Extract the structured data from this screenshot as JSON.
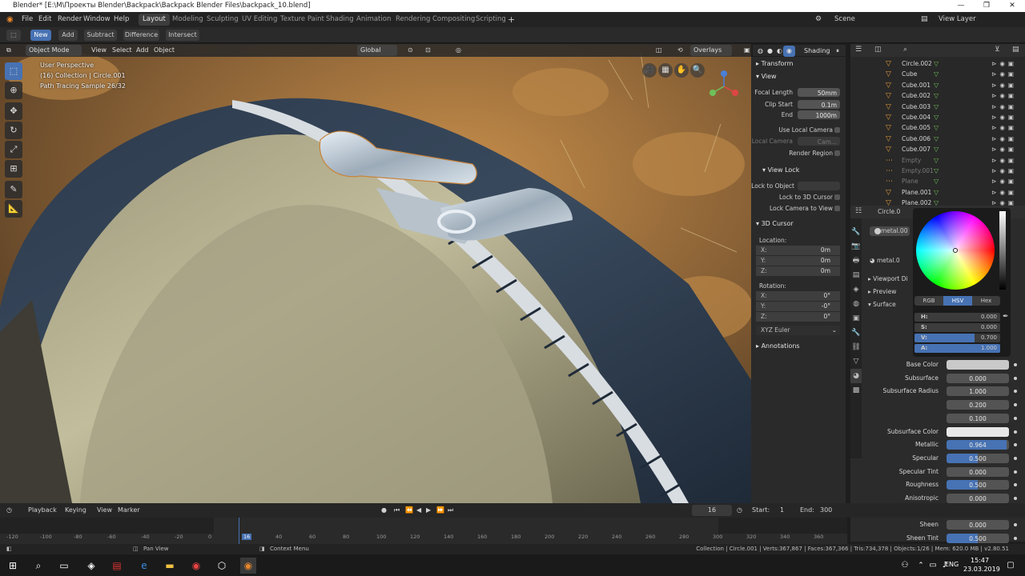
{
  "window": {
    "title": "Blender* [E:\\M\\Проекты Blender\\Backpack\\Backpack Blender Files\\backpack_10.blend]"
  },
  "menu": {
    "items": [
      "File",
      "Edit",
      "Render",
      "Window",
      "Help"
    ]
  },
  "workspaces": [
    "Layout",
    "Modeling",
    "Sculpting",
    "UV Editing",
    "Texture Paint",
    "Shading",
    "Animation",
    "Rendering",
    "Compositing",
    "Scripting"
  ],
  "scene": {
    "name": "Scene",
    "view_layer": "View Layer"
  },
  "bool_header": {
    "new": "New",
    "add": "Add",
    "subtract": "Subtract",
    "difference": "Difference",
    "intersect": "Intersect"
  },
  "viewport": {
    "mode": "Object Mode",
    "view": "View",
    "select": "Select",
    "add": "Add",
    "object": "Object",
    "orientation": "Global",
    "overlays": "Overlays",
    "shading": "Shading",
    "info": [
      "User Perspective",
      "(16) Collection | Circle.001",
      "Path Tracing Sample 26/32"
    ]
  },
  "npanel": {
    "transform": "Transform",
    "view": "View",
    "focal_length_label": "Focal Length",
    "focal_length": "50mm",
    "clip_start_label": "Clip Start",
    "clip_start": "0.1m",
    "end_label": "End",
    "end": "1000m",
    "use_local_camera": "Use Local Camera",
    "local_camera": "Local Camera",
    "local_camera_val": "Cam...",
    "render_region": "Render Region",
    "view_lock": "View Lock",
    "lock_to_object": "Lock to Object",
    "lock_to_3d_cursor": "Lock to 3D Cursor",
    "lock_camera": "Lock Camera to View",
    "cursor": "3D Cursor",
    "location": "Location:",
    "loc": [
      {
        "axis": "X:",
        "v": "0m"
      },
      {
        "axis": "Y:",
        "v": "0m"
      },
      {
        "axis": "Z:",
        "v": "0m"
      }
    ],
    "rotation": "Rotation:",
    "rot": [
      {
        "axis": "X:",
        "v": "0°"
      },
      {
        "axis": "Y:",
        "v": "-0°"
      },
      {
        "axis": "Z:",
        "v": "0°"
      }
    ],
    "rot_mode": "XYZ Euler",
    "annotations": "Annotations"
  },
  "outliner": {
    "items": [
      {
        "name": "Circle.002",
        "dim": false
      },
      {
        "name": "Cube",
        "dim": false
      },
      {
        "name": "Cube.001",
        "dim": false
      },
      {
        "name": "Cube.002",
        "dim": false
      },
      {
        "name": "Cube.003",
        "dim": false
      },
      {
        "name": "Cube.004",
        "dim": false
      },
      {
        "name": "Cube.005",
        "dim": false
      },
      {
        "name": "Cube.006",
        "dim": false
      },
      {
        "name": "Cube.007",
        "dim": false
      },
      {
        "name": "Empty",
        "dim": true
      },
      {
        "name": "Empty.001",
        "dim": true
      },
      {
        "name": "Plane",
        "dim": true
      },
      {
        "name": "Plane.001",
        "dim": false
      },
      {
        "name": "Plane.002",
        "dim": false
      }
    ]
  },
  "props": {
    "object": "Circle.0",
    "material_slot": "metal.00",
    "material": "metal.0",
    "viewport_display": "Viewport Di",
    "preview": "Preview",
    "surface": "Surface",
    "rows": [
      {
        "label": "Base Color",
        "value": "",
        "kind": "color",
        "color": "#c9c9c9"
      },
      {
        "label": "Subsurface",
        "value": "0.000",
        "kind": "num",
        "fill": 0
      },
      {
        "label": "Subsurface Radius",
        "value": "1.000",
        "kind": "num",
        "fill": 0
      },
      {
        "label": "",
        "value": "0.200",
        "kind": "num",
        "fill": 0
      },
      {
        "label": "",
        "value": "0.100",
        "kind": "num",
        "fill": 0
      },
      {
        "label": "Subsurface Color",
        "value": "",
        "kind": "color",
        "color": "#e8e8e8"
      },
      {
        "label": "Metallic",
        "value": "0.964",
        "kind": "num",
        "fill": 0.964
      },
      {
        "label": "Specular",
        "value": "0.500",
        "kind": "num",
        "fill": 0.5
      },
      {
        "label": "Specular Tint",
        "value": "0.000",
        "kind": "num",
        "fill": 0
      },
      {
        "label": "Roughness",
        "value": "0.500",
        "kind": "num",
        "fill": 0.5
      },
      {
        "label": "Anisotropic",
        "value": "0.000",
        "kind": "num",
        "fill": 0
      },
      {
        "label": "Anisotropic Rotation",
        "value": "0.000",
        "kind": "num",
        "fill": 0
      },
      {
        "label": "Sheen",
        "value": "0.000",
        "kind": "num",
        "fill": 0
      },
      {
        "label": "Sheen Tint",
        "value": "0.500",
        "kind": "num",
        "fill": 0.5
      }
    ]
  },
  "color_picker": {
    "modes": [
      "RGB",
      "HSV",
      "Hex"
    ],
    "active_mode": "HSV",
    "h_label": "H:",
    "h": "0.000",
    "s_label": "S:",
    "s": "0.000",
    "v_label": "V:",
    "v": "0.700",
    "a_label": "A:",
    "a": "1.000"
  },
  "timeline": {
    "playback": "Playback",
    "keying": "Keying",
    "view": "View",
    "marker": "Marker",
    "frame": "16",
    "start_label": "Start:",
    "start": "1",
    "end_label": "End:",
    "end": "300",
    "ticks": [
      "-120",
      "-100",
      "-80",
      "-60",
      "-40",
      "-20",
      "0",
      "16",
      "40",
      "60",
      "80",
      "100",
      "120",
      "140",
      "160",
      "180",
      "200",
      "220",
      "240",
      "260",
      "280",
      "300",
      "320",
      "340",
      "360"
    ]
  },
  "status": {
    "pan_view": "Pan View",
    "context_menu": "Context Menu",
    "info": "Collection | Circle.001 | Verts:367,867 | Faces:367,366 | Tris:734,378 | Objects:1/26 | Mem: 620.0 MB | v2.80.51"
  },
  "taskbar": {
    "lang": "ENG",
    "time": "15:47",
    "date": "23.03.2019"
  }
}
